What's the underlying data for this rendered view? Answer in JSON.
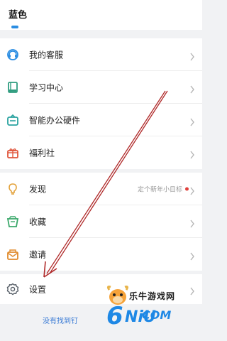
{
  "header": {
    "title": "蓝色"
  },
  "groups": [
    {
      "items": [
        {
          "label": "我的客服",
          "icon": "customer-service-icon"
        },
        {
          "label": "学习中心",
          "icon": "book-icon"
        },
        {
          "label": "智能办公硬件",
          "icon": "device-icon"
        },
        {
          "label": "福利社",
          "icon": "gift-icon"
        }
      ]
    },
    {
      "items": [
        {
          "label": "发现",
          "icon": "bulb-icon",
          "right_text": "定个新年小目标",
          "badge": "red-dot"
        },
        {
          "label": "收藏",
          "icon": "favorites-icon"
        },
        {
          "label": "邀请",
          "icon": "invite-icon"
        }
      ]
    },
    {
      "items": [
        {
          "label": "设置",
          "icon": "gear-icon"
        }
      ]
    }
  ],
  "footer": {
    "link_text": "没有找到钉"
  },
  "watermark": {
    "brand": "乐牛游戏网",
    "domain": "COM"
  },
  "colors": {
    "accent_blue": "#2b8de2",
    "annotation_red": "#b02a2a",
    "badge_red": "#e0403b"
  }
}
